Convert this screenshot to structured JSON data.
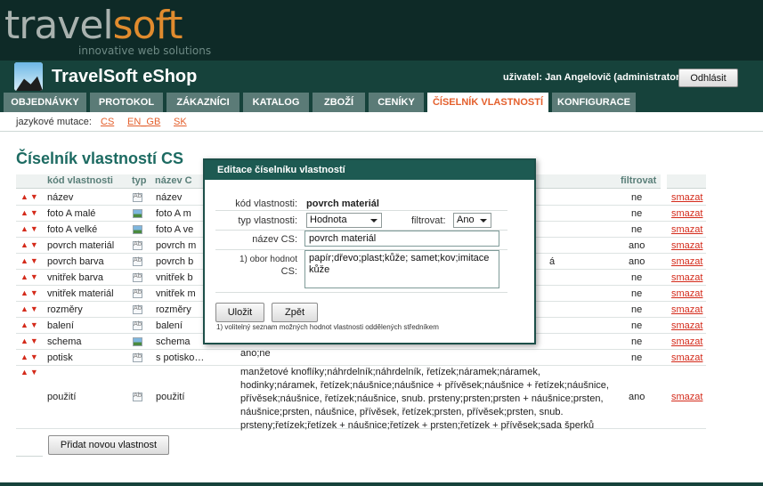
{
  "brand": {
    "logo_part1": "travel",
    "logo_part2": "soft",
    "tagline": "innovative web solutions"
  },
  "shop": {
    "title": "TravelSoft eShop",
    "user": "uživatel: Jan Angelovič (administrator)",
    "logout": "Odhlásit"
  },
  "nav": [
    {
      "label": "OBJEDNÁVKY"
    },
    {
      "label": "PROTOKOL"
    },
    {
      "label": "ZÁKAZNÍCI"
    },
    {
      "label": "KATALOG"
    },
    {
      "label": "ZBOŽÍ"
    },
    {
      "label": "CENÍKY"
    },
    {
      "label": "ČÍSELNÍK VLASTNOSTÍ"
    },
    {
      "label": "KONFIGURACE"
    }
  ],
  "lang": {
    "label": "jazykové mutace:",
    "items": [
      "CS",
      "EN_GB",
      "SK"
    ]
  },
  "page_title": "Číselník vlastností CS",
  "table": {
    "headers": {
      "code": "kód vlastnosti",
      "type": "typ",
      "name": "název C",
      "filter": "filtrovat"
    },
    "rows": [
      {
        "code": "název",
        "icon": "text-type-icon",
        "name": "název",
        "filter": "ne",
        "delete": "smazat"
      },
      {
        "code": "foto A malé",
        "icon": "image-type-icon",
        "name": "foto A m",
        "filter": "ne",
        "delete": "smazat"
      },
      {
        "code": "foto A velké",
        "icon": "image-type-icon",
        "name": "foto A ve",
        "filter": "ne",
        "delete": "smazat"
      },
      {
        "code": "povrch materiál",
        "icon": "text-type-icon",
        "name": "povrch m",
        "filter": "ano",
        "delete": "smazat"
      },
      {
        "code": "povrch barva",
        "icon": "text-type-icon",
        "name": "povrch b",
        "extra": "á",
        "filter": "ano",
        "delete": "smazat"
      },
      {
        "code": "vnitřek barva",
        "icon": "text-type-icon",
        "name": "vnitřek b",
        "filter": "ne",
        "delete": "smazat"
      },
      {
        "code": "vnitřek materiál",
        "icon": "text-type-icon",
        "name": "vnitřek m",
        "filter": "ne",
        "delete": "smazat"
      },
      {
        "code": "rozměry",
        "icon": "text-type-icon",
        "name": "rozměry",
        "filter": "ne",
        "delete": "smazat"
      },
      {
        "code": "balení",
        "icon": "text-type-icon",
        "name": "balení",
        "filter": "ne",
        "delete": "smazat"
      },
      {
        "code": "schema",
        "icon": "image-type-icon",
        "name": "schema",
        "filter": "ne",
        "delete": "smazat"
      },
      {
        "code": "potisk",
        "icon": "text-type-icon",
        "name": "s potisko…",
        "extra": "ano;ne",
        "filter": "ne",
        "delete": "smazat"
      },
      {
        "code": "použití",
        "icon": "text-type-icon",
        "name": "použití",
        "values": "manžetové knoflíky;náhrdelník;náhrdelník, řetízek;náramek;náramek, hodinky;náramek, řetízek;náušnice;náušnice + přívěsek;náušnice + řetízek;náušnice, přívěsek;náušnice, řetízek;náušnice, snub. prsteny;prsten;prsten + náušnice;prsten, náušnice;prsten, náušnice, přívěsek, řetízek;prsten, přívěsek;prsten, snub. prsteny;řetízek;řetízek + náušnice;řetízek + prsten;řetízek + přívěsek;sada šperků",
        "filter": "ano",
        "delete": "smazat"
      }
    ],
    "add_button": "Přidat novou vlastnost"
  },
  "dialog": {
    "title": "Editace číselníku vlastností",
    "code_label": "kód vlastnosti:",
    "code_value": "povrch materiál",
    "type_label": "typ vlastnosti:",
    "type_value": "Hodnota",
    "filter_label": "filtrovat:",
    "filter_value": "Ano",
    "name_label": "název CS:",
    "name_value": "povrch materiál",
    "range_label_1": "1) obor hodnot",
    "range_label_2": "CS:",
    "range_value": "papír;dřevo;plast;kůže; samet;kov;imitace kůže",
    "save": "Uložit",
    "back": "Zpět",
    "footnote": "1) volitelný seznam možných hodnot vlastnosti oddělených středníkem"
  }
}
